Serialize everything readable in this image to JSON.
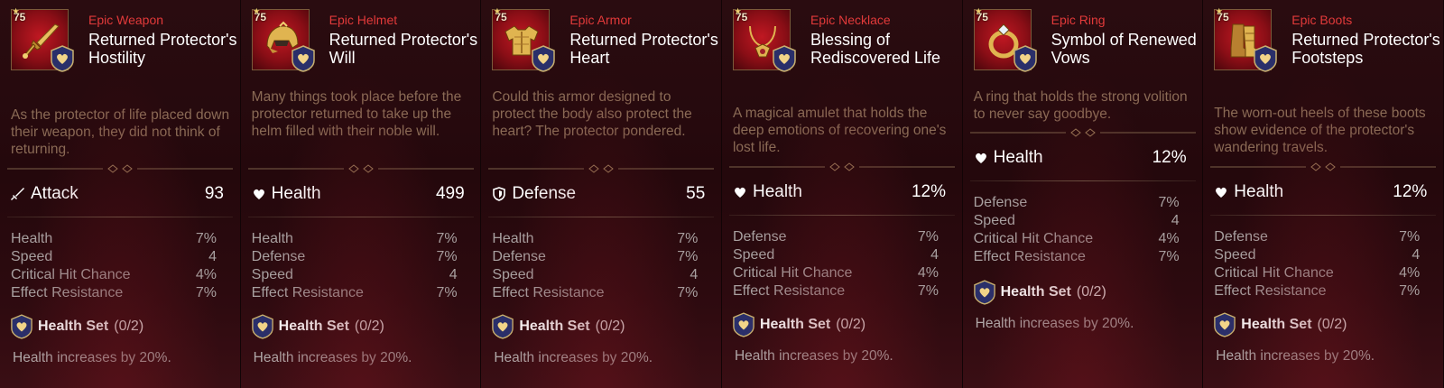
{
  "cards": [
    {
      "level": "75",
      "rarity": "Epic Weapon",
      "name": "Returned Protector's Hostility",
      "description": "As the protector of life placed down their weapon, they did not think of returning.",
      "main_stat": {
        "label": "Attack",
        "value": "93",
        "icon": "sword-icon"
      },
      "substats": [
        {
          "label": "Health",
          "value": "7%"
        },
        {
          "label": "Speed",
          "value": "4"
        },
        {
          "label": "Critical Hit Chance",
          "value": "4%"
        },
        {
          "label": "Effect Resistance",
          "value": "7%"
        }
      ],
      "set_name": "Health Set",
      "set_count": "(0/2)",
      "set_effect": "Health increases by 20%."
    },
    {
      "level": "75",
      "rarity": "Epic Helmet",
      "name": "Returned Protector's Will",
      "description": "Many things took place before the protector returned to take up the helm filled with their noble will.",
      "main_stat": {
        "label": "Health",
        "value": "499",
        "icon": "heart-icon"
      },
      "substats": [
        {
          "label": "Health",
          "value": "7%"
        },
        {
          "label": "Defense",
          "value": "7%"
        },
        {
          "label": "Speed",
          "value": "4"
        },
        {
          "label": "Effect Resistance",
          "value": "7%"
        }
      ],
      "set_name": "Health Set",
      "set_count": "(0/2)",
      "set_effect": "Health increases by 20%."
    },
    {
      "level": "75",
      "rarity": "Epic Armor",
      "name": "Returned Protector's Heart",
      "description": "Could this armor designed to protect the body also protect the heart? The protector pondered.",
      "main_stat": {
        "label": "Defense",
        "value": "55",
        "icon": "shield-icon"
      },
      "substats": [
        {
          "label": "Health",
          "value": "7%"
        },
        {
          "label": "Defense",
          "value": "7%"
        },
        {
          "label": "Speed",
          "value": "4"
        },
        {
          "label": "Effect Resistance",
          "value": "7%"
        }
      ],
      "set_name": "Health Set",
      "set_count": "(0/2)",
      "set_effect": "Health increases by 20%."
    },
    {
      "level": "75",
      "rarity": "Epic Necklace",
      "name": "Blessing of Rediscovered Life",
      "description": "A magical amulet that holds the deep emotions of recovering one's lost life.",
      "main_stat": {
        "label": "Health",
        "value": "12%",
        "icon": "heart-icon"
      },
      "substats": [
        {
          "label": "Defense",
          "value": "7%"
        },
        {
          "label": "Speed",
          "value": "4"
        },
        {
          "label": "Critical Hit Chance",
          "value": "4%"
        },
        {
          "label": "Effect Resistance",
          "value": "7%"
        }
      ],
      "set_name": "Health Set",
      "set_count": "(0/2)",
      "set_effect": "Health increases by 20%."
    },
    {
      "level": "75",
      "rarity": "Epic Ring",
      "name": "Symbol of Renewed Vows",
      "description": "A ring that holds the strong volition to never say goodbye.",
      "main_stat": {
        "label": "Health",
        "value": "12%",
        "icon": "heart-icon"
      },
      "substats": [
        {
          "label": "Defense",
          "value": "7%"
        },
        {
          "label": "Speed",
          "value": "4"
        },
        {
          "label": "Critical Hit Chance",
          "value": "4%"
        },
        {
          "label": "Effect Resistance",
          "value": "7%"
        }
      ],
      "set_name": "Health Set",
      "set_count": "(0/2)",
      "set_effect": "Health increases by 20%."
    },
    {
      "level": "75",
      "rarity": "Epic Boots",
      "name": "Returned Protector's Footsteps",
      "description": "The worn-out heels of these boots show evidence of the protector's wandering travels.",
      "main_stat": {
        "label": "Health",
        "value": "12%",
        "icon": "heart-icon"
      },
      "substats": [
        {
          "label": "Defense",
          "value": "7%"
        },
        {
          "label": "Speed",
          "value": "4"
        },
        {
          "label": "Critical Hit Chance",
          "value": "4%"
        },
        {
          "label": "Effect Resistance",
          "value": "7%"
        }
      ],
      "set_name": "Health Set",
      "set_count": "(0/2)",
      "set_effect": "Health increases by 20%."
    }
  ],
  "colors": {
    "rarity": "#e23a3a",
    "description": "#8a6a55",
    "substat": "#a8a0a0",
    "gold": "#d4a650"
  }
}
